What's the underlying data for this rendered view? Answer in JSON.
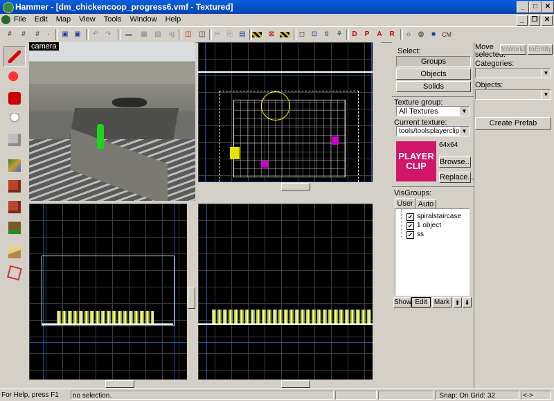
{
  "window": {
    "title": "Hammer - [dm_chickencoop_progress6.vmf - Textured]",
    "minimize": "_",
    "maximize": "□",
    "close": "✕"
  },
  "mdi": {
    "minimize": "_",
    "restore": "❐",
    "close": "✕"
  },
  "menu": [
    "File",
    "Edit",
    "Map",
    "View",
    "Tools",
    "Window",
    "Help"
  ],
  "toolbar": {
    "cordon_label": "CM"
  },
  "viewports": {
    "camera_label": "camera"
  },
  "panel": {
    "select_label": "Select:",
    "groups": "Groups",
    "objects": "Objects",
    "solids": "Solids",
    "move_selected_label": "Move selected:",
    "to_world": "toWorld",
    "to_entity": "toEntity",
    "categories_label": "Categories:",
    "objects_label": "Objects:",
    "create_prefab": "Create Prefab",
    "texture_group_label": "Texture group:",
    "texture_group_value": "All Textures",
    "current_texture_label": "Current texture:",
    "current_texture_value": "tools/toolsplayerclip",
    "texture_preview_text_1": "PLAYER",
    "texture_preview_text_2": "CLIP",
    "texture_size": "64x64",
    "browse": "Browse...",
    "replace": "Replace...",
    "visgroups_label": "VisGroups:",
    "tab_user": "User",
    "tab_auto": "Auto",
    "visgroups": [
      {
        "name": "spiralstaircase",
        "checked": true
      },
      {
        "name": "1 object",
        "checked": true
      },
      {
        "name": "ss",
        "checked": true
      }
    ],
    "show": "Show",
    "edit": "Edit",
    "mark": "Mark",
    "up": "⬆",
    "down": "⬇"
  },
  "status": {
    "help": "For Help, press F1",
    "selection": "no selection.",
    "snap": "Snap: On Grid: 32",
    "nav": "<->"
  }
}
